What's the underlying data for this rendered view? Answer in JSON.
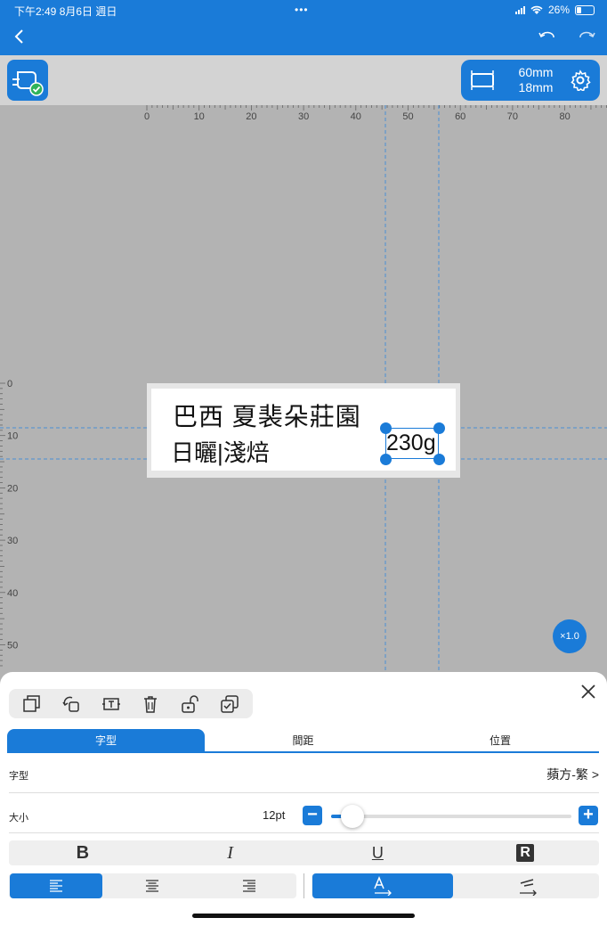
{
  "status_bar": {
    "time": "下午2:49   8月6日 週日",
    "battery": "26%",
    "battery_level": 0.26
  },
  "tape": {
    "width": "60mm",
    "height": "18mm"
  },
  "ruler": {
    "top_ticks": [
      "0",
      "10",
      "20",
      "30",
      "40",
      "50",
      "60",
      "70",
      "80"
    ],
    "left_ticks": [
      "0",
      "10",
      "20",
      "30",
      "40",
      "50"
    ]
  },
  "label": {
    "line1": "巴西 夏裴朵莊園",
    "line2": "日曬|淺焙",
    "selected_text": "230g"
  },
  "zoom": "×1.0",
  "sheet": {
    "tabs": [
      "字型",
      "間距",
      "位置"
    ],
    "active_tab": 0,
    "font_label": "字型",
    "font_value": "蘋方-繁 >",
    "size_label": "大小",
    "size_value": "12pt",
    "size_level": 0.04,
    "styles": [
      "B",
      "I",
      "U",
      "R"
    ]
  },
  "colors": {
    "accent": "#1a7bd8",
    "canvas": "#b3b3b3"
  }
}
